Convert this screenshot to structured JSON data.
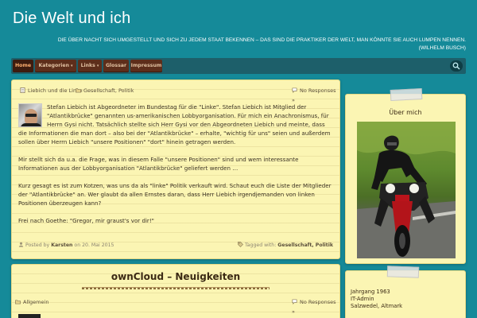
{
  "site": {
    "title": "Die Welt und ich",
    "tagline_line1": "DIE ÜBER NACHT SICH UMGESTELLT UND SICH ZU JEDEM STAAT BEKENNEN – DAS SIND DIE PRAKTIKER DER WELT, MAN KÖNNTE SIE AUCH LUMPEN NENNEN.",
    "tagline_line2": "(WILHELM BUSCH)"
  },
  "nav": {
    "items": [
      "Home",
      "Kategorien",
      "Links",
      "Glossar",
      "Impressum"
    ],
    "caret": "▾"
  },
  "post1": {
    "title_link": "Liebich und die Linke",
    "categories": "Gesellschaft, Politik",
    "responses": "No Responses »",
    "paragraphs": [
      "Stefan Liebich ist Abgeordneter im Bundestag für die \"Linke\". Stefan Liebich ist Mitglied der \"Atlantikbrücke\" genannten us-amerikanischen Lobbyorganisation. Für mich ein Anachronismus, für Herrn Gysi nicht. Tatsächlich stellte sich Herr Gysi vor den Abgeordneten Liebich und meinte, dass die Informationen die man dort – also bei der \"Atlantikbrücke\" – erhalte, \"wichtig für uns\" seien und außerdem sollen über Herrn Liebich \"unsere Positionen\"  \"dort\" hinein getragen werden.",
      "Mir stellt sich da u.a. die Frage, was in diesem Falle \"unsere Positionen\" sind und wem interessante Informationen aus der Lobbyorganisation \"Atlantikbrücke\" geliefert werden …",
      "Kurz gesagt es ist zum Kotzen, was uns da als \"linke\" Politik verkauft wird. Schaut euch die Liste der Mitglieder der \"Atlantikbrücke\" an. Wer glaubt da allen Ernstes daran, dass Herr Liebich irgendjemanden von linken Positionen überzeugen kann?",
      "Frei nach Goethe: \"Gregor, mir graust's vor dir!\""
    ],
    "posted_by_prefix": "Posted by",
    "author": "Karsten",
    "date_prefix": "on",
    "date": "20. Mai 2015",
    "tagged_prefix": "Tagged with:",
    "tags": "Gesellschaft, Politik"
  },
  "post2": {
    "title": "ownCloud – Neuigkeiten",
    "category": "Allgemein",
    "responses": "No Responses »"
  },
  "sidebar": {
    "about_title": "Über mich",
    "info_line1": "Jahrgang 1963",
    "info_line2": "IT-Admin",
    "info_line3": "Salzwedel, Altmark"
  },
  "colors": {
    "background": "#158a99",
    "paper": "#fbf5b3",
    "nav_item": "#5d2e1b",
    "nav_active_text": "#ffb070"
  }
}
